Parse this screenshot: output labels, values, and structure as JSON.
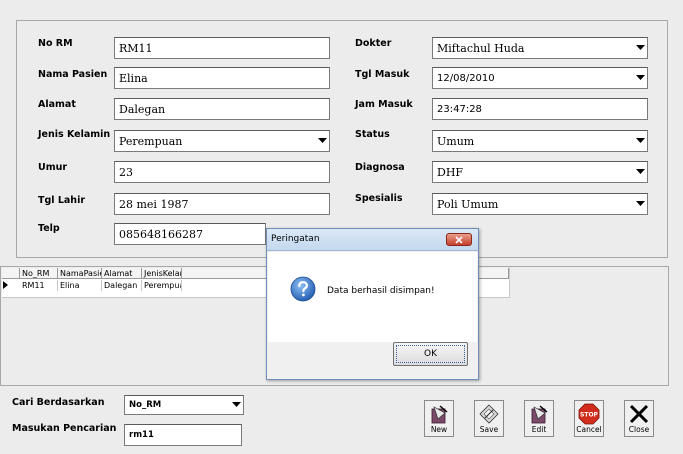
{
  "form": {
    "labels": {
      "no_rm": "No RM",
      "nama_pasien": "Nama Pasien",
      "alamat": "Alamat",
      "jenis_kelamin": "Jenis Kelamin",
      "umur": "Umur",
      "tgl_lahir": "Tgl Lahir",
      "telp": "Telp",
      "dokter": "Dokter",
      "tgl_masuk": "Tgl Masuk",
      "jam_masuk": "Jam Masuk",
      "status": "Status",
      "diagnosa": "Diagnosa",
      "spesialis": "Spesialis"
    },
    "values": {
      "no_rm": "RM11",
      "nama_pasien": "Elina",
      "alamat": "Dalegan",
      "jenis_kelamin": "Perempuan",
      "umur": "23",
      "tgl_lahir": "28 mei 1987",
      "telp": "085648166287",
      "dokter": "Miftachul Huda",
      "tgl_masuk": "12/08/2010",
      "jam_masuk": "23:47:28",
      "status": "Umum",
      "diagnosa": "DHF",
      "spesialis": "Poli Umum"
    }
  },
  "grid": {
    "columns": [
      "No_RM",
      "NamaPasien",
      "Alamat",
      "JenisKelar"
    ],
    "rows": [
      [
        "RM11",
        "Elina",
        "Dalegan",
        "Perempua"
      ]
    ]
  },
  "search": {
    "cari_label": "Cari Berdasarkan",
    "cari_value": "No_RM",
    "masukan_label": "Masukan Pencarian",
    "masukan_value": "rm11"
  },
  "buttons": {
    "new": "New",
    "save": "Save",
    "edit": "Edit",
    "cancel": "Cancel",
    "stop": "STOP",
    "close": "Close"
  },
  "dialog": {
    "title": "Peringatan",
    "message": "Data berhasil disimpan!",
    "ok": "OK"
  },
  "colors": {
    "dialog_close": "#c6402a",
    "stop_red": "#d22c1c",
    "question_blue": "#2d6cc0"
  }
}
